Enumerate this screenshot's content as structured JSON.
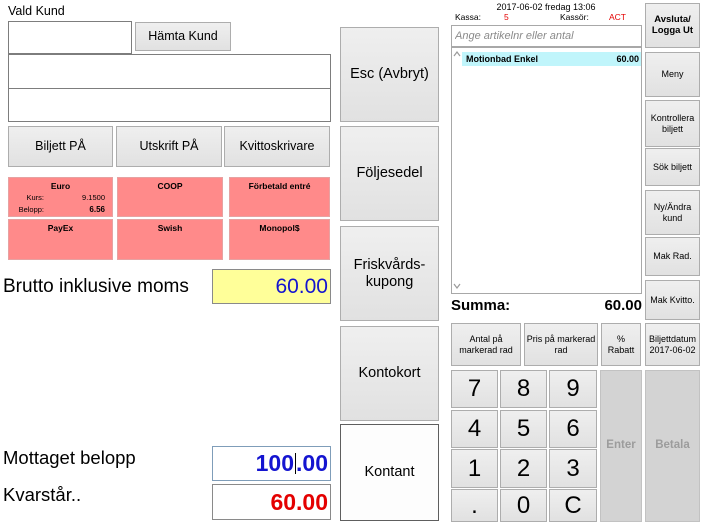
{
  "customer": {
    "title": "Vald Kund",
    "id_value": "",
    "fetch_button": "Hämta Kund",
    "name_value": "",
    "address_value": ""
  },
  "settings_buttons": [
    "Biljett PÅ",
    "Utskrift PÅ",
    "Kvittoskrivare"
  ],
  "payment_methods": [
    {
      "label": "Euro",
      "rate_label": "Kurs:",
      "rate": "9.1500",
      "amount_label": "Belopp:",
      "amount": "6.56"
    },
    {
      "label": "COOP"
    },
    {
      "label": "Förbetald entré"
    },
    {
      "label": "PayEx"
    },
    {
      "label": "Swish"
    },
    {
      "label": "Monopol$"
    }
  ],
  "totals": {
    "gross_label": "Brutto inklusive moms",
    "gross_value": "60.00",
    "received_label": "Mottaget belopp",
    "received_value": "100.00",
    "remaining_label": "Kvarstår..",
    "remaining_value": "60.00"
  },
  "tender_buttons": [
    {
      "label": "Esc (Avbryt)"
    },
    {
      "label": "Följesedel"
    },
    {
      "label": "Friskvårds-kupong"
    },
    {
      "label": "Kontokort"
    },
    {
      "label": "Kontant",
      "focused": true
    }
  ],
  "session": {
    "datetime": "2017-06-02 fredag 13:06",
    "register_label": "Kassa:",
    "register": "5",
    "cashier_label": "Kassör:",
    "cashier": "ACT"
  },
  "article_input": {
    "value": "",
    "placeholder": "Ange artikelnr eller antal"
  },
  "receipt": {
    "scroll_icons": [
      "chevron-up-icon",
      "chevron-down-icon"
    ],
    "rows": [
      {
        "name": "Motionbad Enkel",
        "price": "60.00",
        "selected": true
      }
    ]
  },
  "sum": {
    "label": "Summa:",
    "value": "60.00"
  },
  "row_actions": [
    "Antal på markerad rad",
    "Pris på markerad rad",
    "% Rabatt"
  ],
  "keypad": [
    "7",
    "8",
    "9",
    "4",
    "5",
    "6",
    "1",
    "2",
    "3",
    ".",
    "0",
    "C"
  ],
  "enter_button": {
    "label": "Enter",
    "disabled": true
  },
  "pay_button": {
    "label": "Betala",
    "disabled": true
  },
  "side_menu": [
    "Avsluta/\nLogga Ut",
    "Meny",
    "Kontrollera biljett",
    "Sök biljett",
    "Ny/Ändra kund",
    "Mak Rad.",
    "Mak Kvitto.",
    "Biljettdatum 2017-06-02"
  ],
  "colors": {
    "accent_red": "#e40000",
    "amount_blue": "#1414d0",
    "selection_cyan": "#c0f5fb",
    "payment_pink": "#ff8a8a",
    "total_yellow": "#ffff99",
    "button_grey": "#e1e1e1",
    "disabled_grey": "#d3d3d3"
  }
}
